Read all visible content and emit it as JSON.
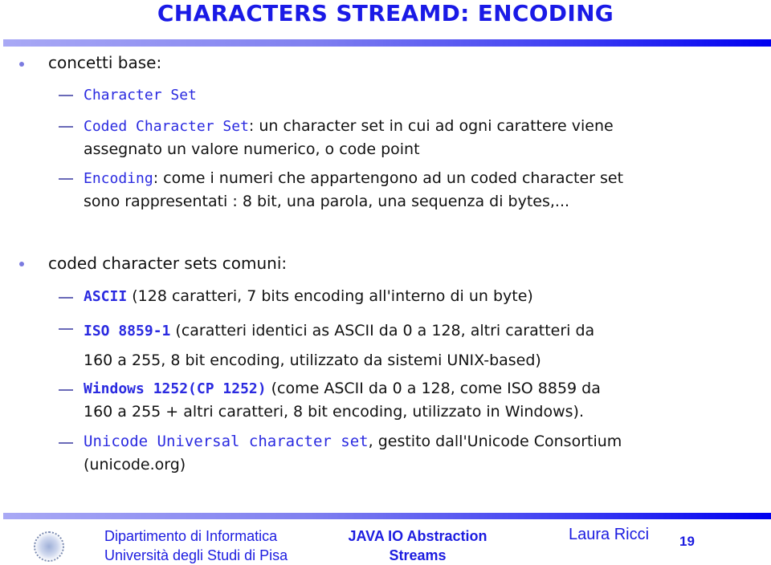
{
  "slide": {
    "title": "CHARACTERS STREAMD: ENCODING",
    "sections": [
      {
        "heading": "concetti base:",
        "items": [
          {
            "code": "Character Set",
            "text": ""
          },
          {
            "code": "Coded Character Set",
            "text_line1": ": un character set in cui ad ogni carattere viene",
            "text_line2": "assegnato un valore numerico, o code point"
          },
          {
            "code": "Encoding",
            "text_line1": ": come i numeri che appartengono ad un coded character set",
            "text_line2": "sono rappresentati : 8 bit, una parola, una sequenza di bytes,..."
          }
        ]
      },
      {
        "heading": "coded character sets comuni:",
        "items": [
          {
            "code": "ASCII",
            "text_line1": " (128 caratteri, 7 bits encoding all'interno di un byte)"
          },
          {
            "code": "ISO 8859-1",
            "text_line1": " (caratteri identici as ASCII da 0 a 128, altri caratteri da",
            "text_line2": "160 a 255, 8 bit encoding, utilizzato da sistemi UNIX-based)"
          },
          {
            "code": "Windows 1252(CP 1252)",
            "text_line1": " (come ASCII da 0 a 128, come ISO 8859 da",
            "text_line2": "160 a 255 + altri caratteri, 8 bit encoding, utilizzato in Windows)."
          },
          {
            "code": "Unicode Universal character set",
            "text_line1": ", gestito dall'Unicode Consortium",
            "text_line2": "(unicode.org)"
          }
        ]
      }
    ]
  },
  "footer": {
    "department": "Dipartimento di Informatica",
    "university": "Università degli Studi di Pisa",
    "course_line1": "JAVA IO Abstraction",
    "course_line2": "Streams",
    "author": "Laura Ricci",
    "page_number": "19",
    "logo": "university-seal-icon"
  },
  "colors": {
    "title": "#1a1ae6",
    "code": "#2a2ae0",
    "bullet": "#7b7be0",
    "footer_text": "#1c1ce0",
    "bar_start": "#a9a9f5",
    "bar_end": "#0000f0"
  }
}
